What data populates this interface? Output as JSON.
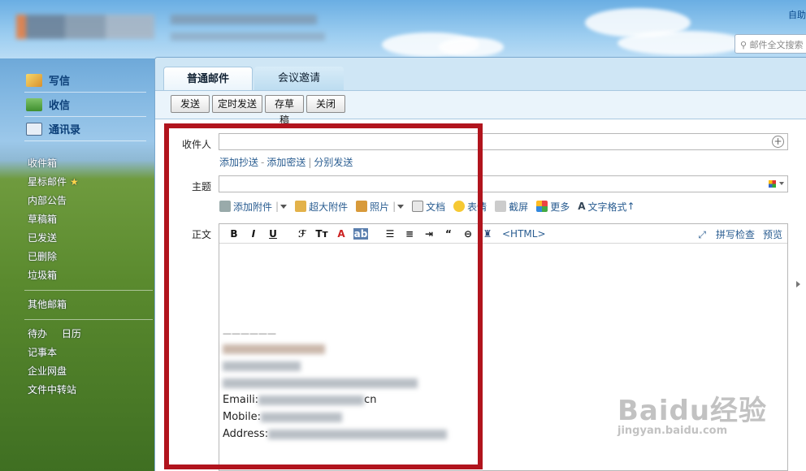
{
  "header": {
    "top_link": "自助",
    "search_placeholder": "邮件全文搜索"
  },
  "sidebar": {
    "main_nav": [
      {
        "label": "写信",
        "icon": "compose-icon"
      },
      {
        "label": "收信",
        "icon": "inbox-download-icon"
      },
      {
        "label": "通讯录",
        "icon": "contacts-card-icon"
      }
    ],
    "folders": [
      "收件箱",
      "星标邮件",
      "内部公告",
      "草稿箱",
      "已发送",
      "已删除",
      "垃圾箱"
    ],
    "other_mailbox": "其他邮箱",
    "todo": "待办",
    "calendar": "日历",
    "tools": [
      "记事本",
      "企业网盘",
      "文件中转站"
    ]
  },
  "compose": {
    "tabs": [
      "普通邮件",
      "会议邀请"
    ],
    "toolbar": [
      "发送",
      "定时发送",
      "存草稿",
      "关闭"
    ],
    "to_label": "收件人",
    "links": [
      "添加抄送",
      "添加密送",
      "分别发送"
    ],
    "subject_label": "主题",
    "attach_tools": [
      "添加附件",
      "超大附件",
      "照片",
      "文档",
      "表情",
      "截屏",
      "更多",
      "文字格式"
    ],
    "body_label": "正文",
    "format_tools": [
      "B",
      "I",
      "U"
    ],
    "html_label": "<HTML>",
    "spellcheck": "拼写检查",
    "preview": "预览",
    "signature": {
      "divider": "——————",
      "email_label": "Emaili:",
      "email_tail": "cn",
      "mobile_label": "Mobile:",
      "address_label": "Address:"
    }
  },
  "watermark": {
    "brand": "Baidu经验",
    "url": "jingyan.baidu.com"
  }
}
